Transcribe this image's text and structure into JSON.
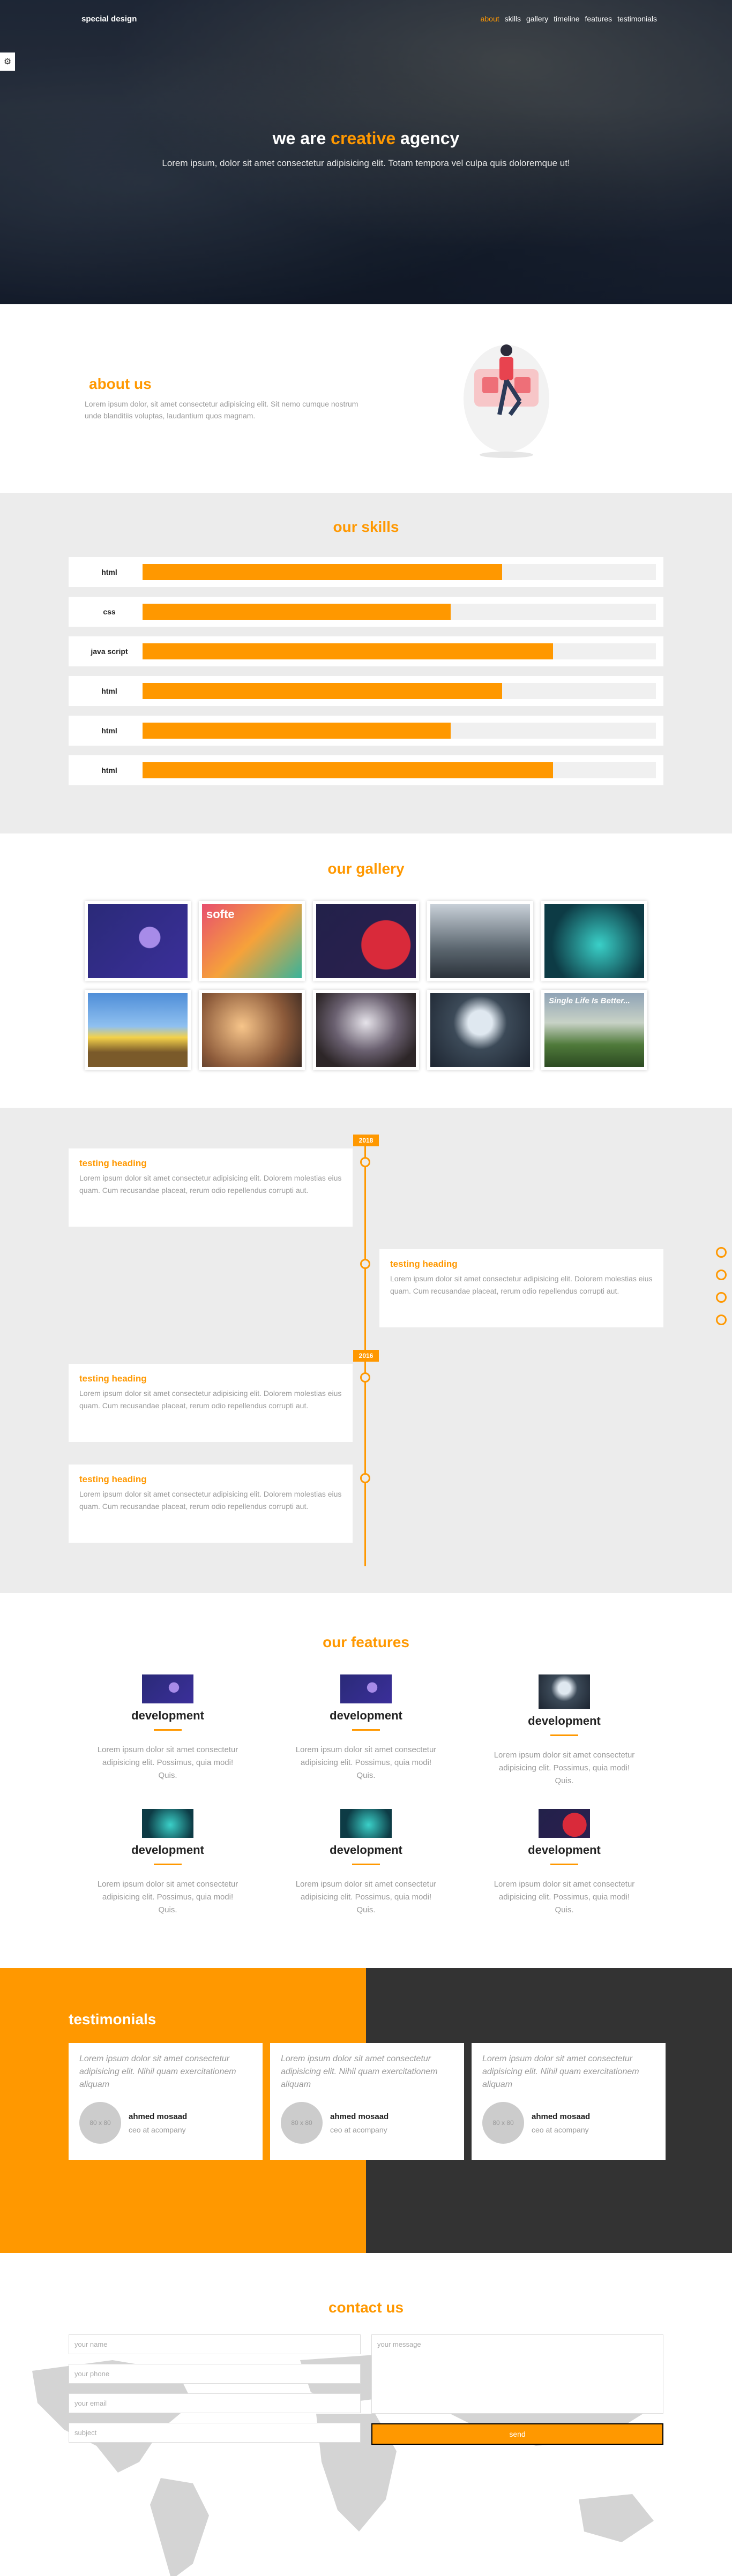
{
  "brand": "special design",
  "nav": [
    "about",
    "skills",
    "gallery",
    "timeline",
    "features",
    "testimonials"
  ],
  "hero": {
    "title_pre": "we are ",
    "title_hl": "creative",
    "title_post": " agency",
    "subtitle": "Lorem ipsum, dolor sit amet consectetur adipisicing elit. Totam tempora vel culpa quis doloremque ut!"
  },
  "about": {
    "title": "about us",
    "text": "Lorem ipsum dolor, sit amet consectetur adipisicing elit. Sit nemo cumque nostrum unde blanditiis voluptas, laudantium quos magnam."
  },
  "skills": {
    "title": "our skills",
    "items": [
      {
        "name": "html",
        "level": 0.7
      },
      {
        "name": "css",
        "level": 0.6
      },
      {
        "name": "java script",
        "level": 0.8
      },
      {
        "name": "html",
        "level": 0.7
      },
      {
        "name": "html",
        "level": 0.6
      },
      {
        "name": "html",
        "level": 0.8
      }
    ]
  },
  "gallery": {
    "title": "our gallery",
    "tile_label": "softe",
    "tile_label_2": "Single Life Is Better..."
  },
  "timeline": {
    "years": [
      "2018",
      "2016"
    ],
    "cards": [
      {
        "title": "testing heading",
        "text": "Lorem ipsum dolor sit amet consectetur adipisicing elit. Dolorem molestias eius quam. Cum recusandae placeat, rerum odio repellendus corrupti aut."
      },
      {
        "title": "testing heading",
        "text": "Lorem ipsum dolor sit amet consectetur adipisicing elit. Dolorem molestias eius quam. Cum recusandae placeat, rerum odio repellendus corrupti aut."
      },
      {
        "title": "testing heading",
        "text": "Lorem ipsum dolor sit amet consectetur adipisicing elit. Dolorem molestias eius quam. Cum recusandae placeat, rerum odio repellendus corrupti aut."
      },
      {
        "title": "testing heading",
        "text": "Lorem ipsum dolor sit amet consectetur adipisicing elit. Dolorem molestias eius quam. Cum recusandae placeat, rerum odio repellendus corrupti aut."
      }
    ]
  },
  "features": {
    "title": "our features",
    "items": [
      {
        "title": "development",
        "text": "Lorem ipsum dolor sit amet consectetur adipisicing elit. Possimus, quia modi! Quis."
      },
      {
        "title": "development",
        "text": "Lorem ipsum dolor sit amet consectetur adipisicing elit. Possimus, quia modi! Quis."
      },
      {
        "title": "development",
        "text": "Lorem ipsum dolor sit amet consectetur adipisicing elit. Possimus, quia modi! Quis."
      },
      {
        "title": "development",
        "text": "Lorem ipsum dolor sit amet consectetur adipisicing elit. Possimus, quia modi! Quis."
      },
      {
        "title": "development",
        "text": "Lorem ipsum dolor sit amet consectetur adipisicing elit. Possimus, quia modi! Quis."
      },
      {
        "title": "development",
        "text": "Lorem ipsum dolor sit amet consectetur adipisicing elit. Possimus, quia modi! Quis."
      }
    ]
  },
  "testimonials": {
    "title": "testimonials",
    "items": [
      {
        "quote": "Lorem ipsum dolor sit amet consectetur adipisicing elit. Nihil quam exercitationem aliquam",
        "name": "ahmed mosaad",
        "role": "ceo at acompany",
        "avatar": "80 x 80"
      },
      {
        "quote": "Lorem ipsum dolor sit amet consectetur adipisicing elit. Nihil quam exercitationem aliquam",
        "name": "ahmed mosaad",
        "role": "ceo at acompany",
        "avatar": "80 x 80"
      },
      {
        "quote": "Lorem ipsum dolor sit amet consectetur adipisicing elit. Nihil quam exercitationem aliquam",
        "name": "ahmed mosaad",
        "role": "ceo at acompany",
        "avatar": "80 x 80"
      }
    ]
  },
  "contact": {
    "title": "contact us",
    "name_placeholder": "your name",
    "phone_placeholder": "your phone",
    "email_placeholder": "your email",
    "subject_placeholder": "subject",
    "message_placeholder": "your message",
    "send_label": "send"
  },
  "colors": {
    "accent": "#ff9800",
    "dark": "#333333",
    "light_bg": "#ececec"
  }
}
